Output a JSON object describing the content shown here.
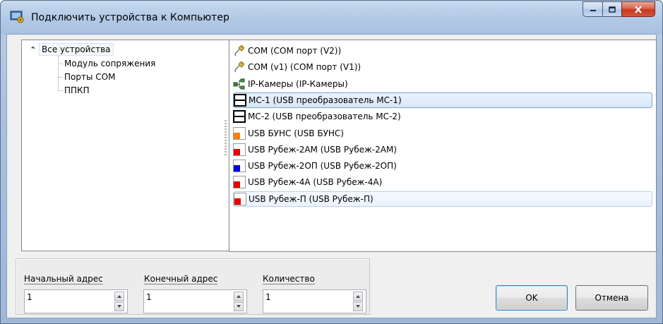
{
  "window": {
    "title": "Подключить устройства к Компьютер"
  },
  "tree": {
    "root": "Все устройства",
    "children": [
      "Модуль сопряжения",
      "Порты COM",
      "ППКП"
    ]
  },
  "devices": [
    {
      "label": "COM (COM порт (V2))",
      "icon": "com-plug-icon"
    },
    {
      "label": "COM (v1) (COM порт (V1))",
      "icon": "com-plug-icon"
    },
    {
      "label": "IP-Камеры (IP-Камеры)",
      "icon": "network-icon"
    },
    {
      "label": "МС-1 (USB преобразователь МС-1)",
      "icon": "converter-icon",
      "state": "selected"
    },
    {
      "label": "МС-2 (USB преобразователь МС-2)",
      "icon": "converter-icon"
    },
    {
      "label": "USB БУНС (USB БУНС)",
      "icon": "device-square-icon",
      "color": "#ff8000"
    },
    {
      "label": "USB Рубеж-2АМ (USB Рубеж-2АМ)",
      "icon": "device-square-icon",
      "color": "#e80000"
    },
    {
      "label": "USB Рубеж-2ОП (USB Рубеж-2ОП)",
      "icon": "device-square-icon",
      "color": "#0000e0"
    },
    {
      "label": "USB Рубеж-4А (USB Рубеж-4А)",
      "icon": "device-square-icon",
      "color": "#e80000"
    },
    {
      "label": "USB Рубеж-П (USB Рубеж-П)",
      "icon": "device-square-icon",
      "color": "#e80000",
      "state": "hover"
    }
  ],
  "fields": {
    "start_label": "Начальный адрес",
    "start_value": "1",
    "end_label": "Конечный адрес",
    "end_value": "1",
    "count_label": "Количество",
    "count_value": "1"
  },
  "buttons": {
    "ok": "OK",
    "cancel": "Отмена"
  }
}
